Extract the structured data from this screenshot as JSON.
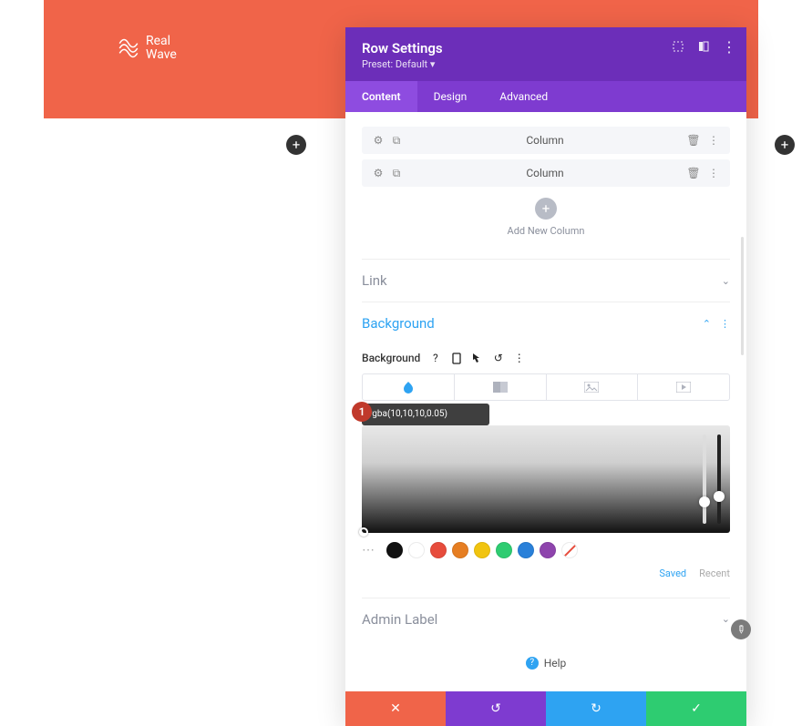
{
  "logo": {
    "line1": "Real",
    "line2": "Wave"
  },
  "panel": {
    "title": "Row Settings",
    "preset_label": "Preset:",
    "preset_value": "Default",
    "tabs": [
      "Content",
      "Design",
      "Advanced"
    ],
    "active_tab": 0
  },
  "columns": [
    {
      "label": "Column"
    },
    {
      "label": "Column"
    }
  ],
  "add_column_label": "Add New Column",
  "sections": {
    "link": "Link",
    "background": "Background",
    "admin_label": "Admin Label"
  },
  "background": {
    "label": "Background",
    "color_value": "rgba(10,10,10,0.05)",
    "swatch_tabs": {
      "saved": "Saved",
      "recent": "Recent"
    },
    "swatches": [
      {
        "name": "black",
        "color": "#111111"
      },
      {
        "name": "white",
        "color": "#ffffff"
      },
      {
        "name": "red",
        "color": "#e74c3c"
      },
      {
        "name": "orange",
        "color": "#e67e22"
      },
      {
        "name": "yellow",
        "color": "#f1c40f"
      },
      {
        "name": "green",
        "color": "#2ecc71"
      },
      {
        "name": "blue",
        "color": "#2980d9"
      },
      {
        "name": "purple",
        "color": "#8e44ad"
      }
    ]
  },
  "help_label": "Help",
  "badge": "1"
}
